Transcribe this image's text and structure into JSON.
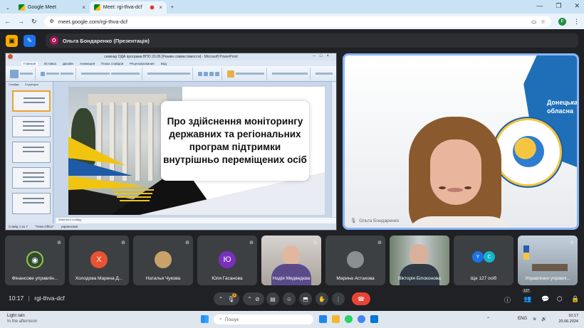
{
  "browser": {
    "tabs": [
      {
        "title": "Google Meet"
      },
      {
        "title": "Meet: rgi-thva-dcf"
      }
    ],
    "new_tab": "+",
    "url": "meet.google.com/rgi-thva-dcf",
    "profile_initial": "F"
  },
  "meet": {
    "presenter_initial": "О",
    "presenter_label": "Ольга Бондаренко (Презентація)",
    "slide": {
      "window_title": "семінар ОДА програми ВПО 20.06 [Режим совместимости] - Microsoft PowerPoint",
      "menu": [
        "Главная",
        "Вставка",
        "Дизайн",
        "Анимация",
        "Показ слайдов",
        "Рецензирование",
        "Вид"
      ],
      "thumb_tabs": [
        "Слайды",
        "Структура"
      ],
      "title_text": "Про здійснення моніторингу державних та регіональних програм підтримки внутрішньо переміщених осіб",
      "status_left": "Слайд 1 из 7",
      "status_theme": "\"Тема Office\"",
      "status_lang": "украинский",
      "notes_placeholder": "Заметки к слайду"
    },
    "speaker": {
      "name": "Ольга Бондаренко",
      "map_text": "Донецька обласна"
    },
    "participants": [
      {
        "name": "Фінансове управлін...",
        "type": "avatar"
      },
      {
        "name": "Холодова Марина Д...",
        "type": "letter",
        "initial": "Х",
        "color": "#e8542f"
      },
      {
        "name": "Наталья Чукова",
        "type": "avatar"
      },
      {
        "name": "Юля Гасанова",
        "type": "letter",
        "initial": "Ю",
        "color": "#7b2fbf"
      },
      {
        "name": "Надія Медведєва",
        "type": "video"
      },
      {
        "name": "Марина Астахова",
        "type": "avatar"
      },
      {
        "name": "Вікторія Білоконова",
        "type": "video"
      },
      {
        "name": "Ще 127 осіб",
        "type": "more",
        "initials": [
          "Y",
          "C"
        ]
      },
      {
        "name": "Управління управлі...",
        "type": "video"
      }
    ],
    "time": "10:17",
    "separator": "|",
    "meeting_code": "rgi-thva-dcf",
    "participant_count": "137",
    "chat_badge": "1"
  },
  "taskbar": {
    "weather_title": "Light rain",
    "weather_sub": "In the afternoon",
    "search_placeholder": "Пошук",
    "lang": "ENG",
    "clock_time": "10:17",
    "clock_date": "20.06.2024"
  }
}
